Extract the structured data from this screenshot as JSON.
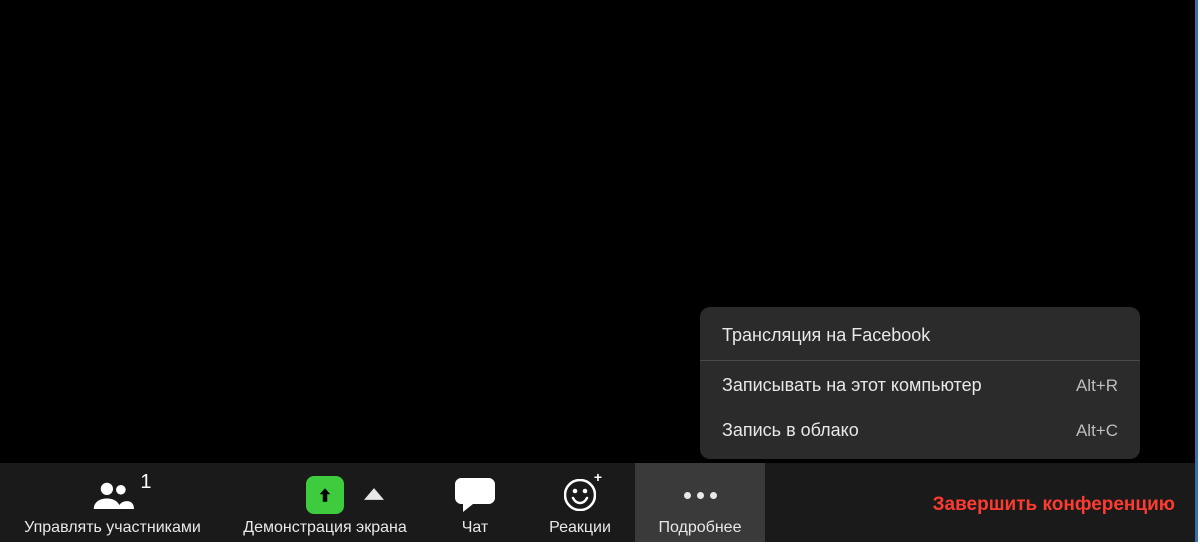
{
  "toolbar": {
    "participants": {
      "label": "Управлять участниками",
      "count": "1"
    },
    "share": {
      "label": "Демонстрация экрана"
    },
    "chat": {
      "label": "Чат"
    },
    "reactions": {
      "label": "Реакции"
    },
    "more": {
      "label": "Подробнее"
    },
    "end": {
      "label": "Завершить конференцию"
    }
  },
  "menu": {
    "items": [
      {
        "label": "Трансляция на Facebook",
        "shortcut": ""
      },
      {
        "label": "Записывать на этот компьютер",
        "shortcut": "Alt+R"
      },
      {
        "label": "Запись в облако",
        "shortcut": "Alt+C"
      }
    ]
  },
  "colors": {
    "toolbar_bg": "#1a1a1a",
    "popup_bg": "#2b2b2b",
    "end_text": "#ff3b30",
    "share_green": "#3ecc3e"
  }
}
